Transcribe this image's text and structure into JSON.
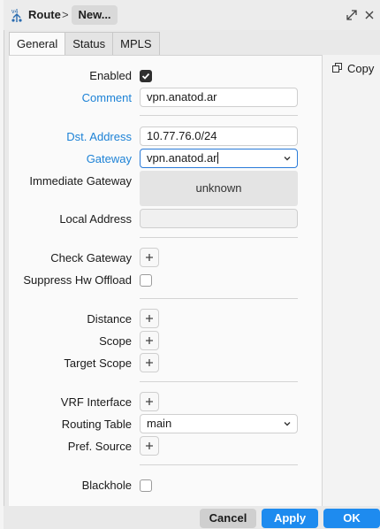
{
  "window": {
    "icon": "ipv4-route-icon",
    "icon_text": "v4",
    "title": "Route",
    "separator": ">",
    "chip": "New..."
  },
  "tabs": [
    {
      "label": "General",
      "active": true
    },
    {
      "label": "Status",
      "active": false
    },
    {
      "label": "MPLS",
      "active": false
    }
  ],
  "side": {
    "copy_label": "Copy"
  },
  "form": {
    "enabled": {
      "label": "Enabled",
      "checked": true
    },
    "comment": {
      "label": "Comment",
      "value": "vpn.anatod.ar"
    },
    "dst_address": {
      "label": "Dst. Address",
      "value": "10.77.76.0/24"
    },
    "gateway": {
      "label": "Gateway",
      "value": "vpn.anatod.ar"
    },
    "immediate_gateway": {
      "label": "Immediate Gateway",
      "value": "unknown"
    },
    "local_address": {
      "label": "Local Address",
      "value": ""
    },
    "check_gateway": {
      "label": "Check Gateway"
    },
    "suppress_hw_offload": {
      "label": "Suppress Hw Offload",
      "checked": false
    },
    "distance": {
      "label": "Distance"
    },
    "scope": {
      "label": "Scope"
    },
    "target_scope": {
      "label": "Target Scope"
    },
    "vrf_interface": {
      "label": "VRF Interface"
    },
    "routing_table": {
      "label": "Routing Table",
      "value": "main"
    },
    "pref_source": {
      "label": "Pref. Source"
    },
    "blackhole": {
      "label": "Blackhole",
      "checked": false
    }
  },
  "footer": {
    "cancel": "Cancel",
    "apply": "Apply",
    "ok": "OK"
  },
  "colors": {
    "accent": "#1e8bef",
    "label_blue": "#1d82d6"
  }
}
